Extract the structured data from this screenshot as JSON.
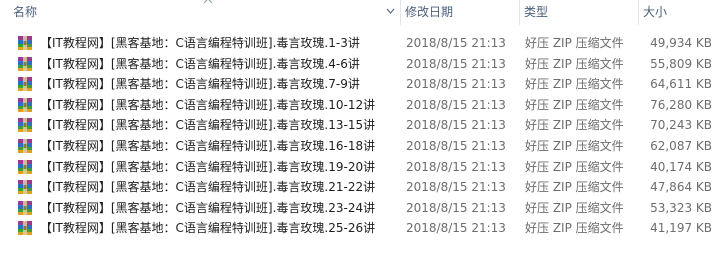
{
  "columns": {
    "name": "名称",
    "date": "修改日期",
    "type": "类型",
    "size": "大小"
  },
  "files": [
    {
      "name": "【IT教程网】[黑客基地：C语言编程特训班].毒言玫瑰.1-3讲",
      "date": "2018/8/15 21:13",
      "type": "好压 ZIP 压缩文件",
      "size": "49,934 KB"
    },
    {
      "name": "【IT教程网】[黑客基地：C语言编程特训班].毒言玫瑰.4-6讲",
      "date": "2018/8/15 21:13",
      "type": "好压 ZIP 压缩文件",
      "size": "55,809 KB"
    },
    {
      "name": "【IT教程网】[黑客基地：C语言编程特训班].毒言玫瑰.7-9讲",
      "date": "2018/8/15 21:13",
      "type": "好压 ZIP 压缩文件",
      "size": "64,611 KB"
    },
    {
      "name": "【IT教程网】[黑客基地：C语言编程特训班].毒言玫瑰.10-12讲",
      "date": "2018/8/15 21:13",
      "type": "好压 ZIP 压缩文件",
      "size": "76,280 KB"
    },
    {
      "name": "【IT教程网】[黑客基地：C语言编程特训班].毒言玫瑰.13-15讲",
      "date": "2018/8/15 21:13",
      "type": "好压 ZIP 压缩文件",
      "size": "70,243 KB"
    },
    {
      "name": "【IT教程网】[黑客基地：C语言编程特训班].毒言玫瑰.16-18讲",
      "date": "2018/8/15 21:13",
      "type": "好压 ZIP 压缩文件",
      "size": "62,087 KB"
    },
    {
      "name": "【IT教程网】[黑客基地：C语言编程特训班].毒言玫瑰.19-20讲",
      "date": "2018/8/15 21:13",
      "type": "好压 ZIP 压缩文件",
      "size": "40,174 KB"
    },
    {
      "name": "【IT教程网】[黑客基地：C语言编程特训班].毒言玫瑰.21-22讲",
      "date": "2018/8/15 21:13",
      "type": "好压 ZIP 压缩文件",
      "size": "47,864 KB"
    },
    {
      "name": "【IT教程网】[黑客基地：C语言编程特训班].毒言玫瑰.23-24讲",
      "date": "2018/8/15 21:13",
      "type": "好压 ZIP 压缩文件",
      "size": "53,323 KB"
    },
    {
      "name": "【IT教程网】[黑客基地：C语言编程特训班].毒言玫瑰.25-26讲",
      "date": "2018/8/15 21:13",
      "type": "好压 ZIP 压缩文件",
      "size": "41,197 KB"
    }
  ],
  "icons": {
    "header_sort": "sort-ascending-icon",
    "header_dropdown": "chevron-down-icon",
    "file": "zip-archive-icon"
  },
  "colors": {
    "header_text": "#4c607a",
    "name_text": "#1e1e1e",
    "detail_text": "#6d6d6d"
  }
}
